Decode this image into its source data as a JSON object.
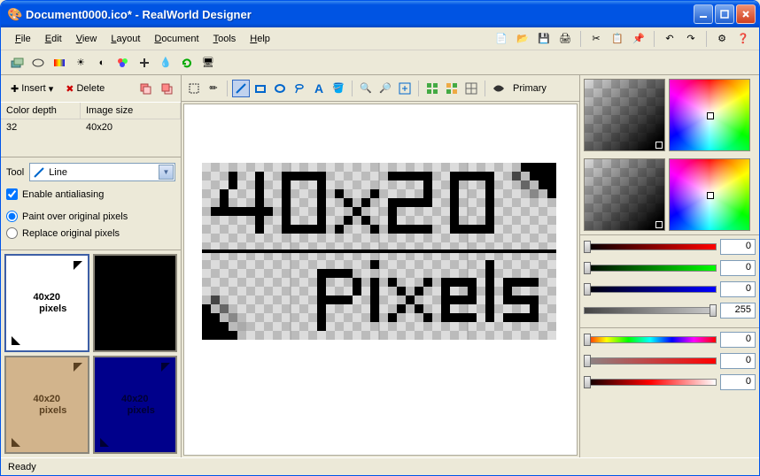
{
  "window": {
    "title": "Document0000.ico* - RealWorld Designer"
  },
  "menu": {
    "file": "File",
    "edit": "Edit",
    "view": "View",
    "layout": "Layout",
    "document": "Document",
    "tools": "Tools",
    "help": "Help"
  },
  "layer_toolbar": {
    "insert": "Insert",
    "delete": "Delete"
  },
  "layer_list": {
    "col_depth": "Color depth",
    "col_size": "Image size",
    "rows": [
      {
        "depth": "32",
        "size": "40x20"
      }
    ]
  },
  "tool_panel": {
    "label": "Tool",
    "selected": "Line",
    "antialias": "Enable antialiasing",
    "paint_over": "Paint over original pixels",
    "replace": "Replace original pixels"
  },
  "canvas_toolbar": {
    "primary": "Primary"
  },
  "canvas": {
    "text1": "40x20",
    "text2": "pixels"
  },
  "sliders_rgba": [
    {
      "color_from": "#000000",
      "color_to": "#ff0000",
      "value": 0,
      "pos": 0
    },
    {
      "color_from": "#000000",
      "color_to": "#00ff00",
      "value": 0,
      "pos": 0
    },
    {
      "color_from": "#000000",
      "color_to": "#0000ff",
      "value": 0,
      "pos": 0
    },
    {
      "color_from": "#000000",
      "color_to": "#ffffff",
      "value": 255,
      "pos": 100
    }
  ],
  "sliders_hsl": [
    {
      "grad": "linear-gradient(to right, red, yellow, lime, cyan, blue, magenta, red)",
      "value": 0,
      "pos": 0
    },
    {
      "grad": "linear-gradient(to right, #808080, #ff0000)",
      "value": 0,
      "pos": 0
    },
    {
      "grad": "linear-gradient(to right, #000000, #ff0000, #ffffff)",
      "value": 0,
      "pos": 0
    }
  ],
  "status": {
    "text": "Ready"
  },
  "previews": [
    {
      "bg": "#ffffff",
      "fg": "#000000",
      "active": true
    },
    {
      "bg": "#000000",
      "fg": "#000000",
      "active": false
    },
    {
      "bg": "#d2b48c",
      "fg": "#5a4020",
      "active": false
    },
    {
      "bg": "#00008b",
      "fg": "#001050",
      "active": false
    }
  ]
}
